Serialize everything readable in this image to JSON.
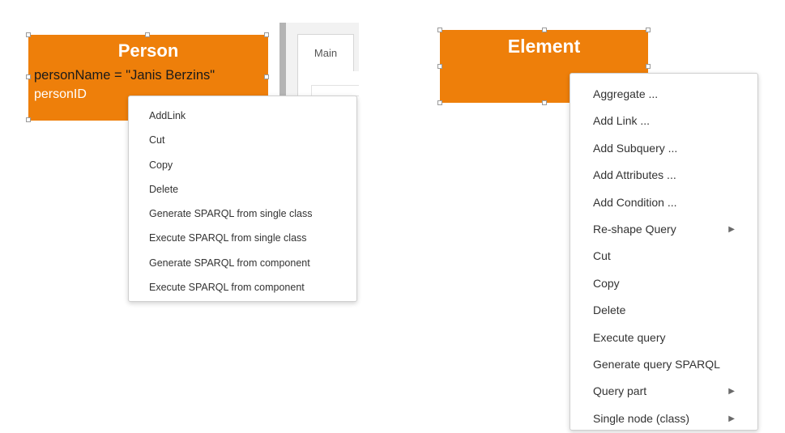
{
  "person_class": {
    "title": "Person",
    "attributes": [
      "personName = \"Janis Berzins\"",
      "personID"
    ]
  },
  "element_class": {
    "title": "Element"
  },
  "side_panel": {
    "tab_label": "Main"
  },
  "left_context_menu": {
    "items": [
      "AddLink",
      "Cut",
      "Copy",
      "Delete",
      "Generate SPARQL from single class",
      "Execute SPARQL from single class",
      "Generate SPARQL from component",
      "Execute SPARQL from component"
    ]
  },
  "right_context_menu": {
    "items": [
      {
        "label": "Aggregate ...",
        "submenu": false
      },
      {
        "label": "Add Link ...",
        "submenu": false
      },
      {
        "label": "Add Subquery ...",
        "submenu": false
      },
      {
        "label": "Add Attributes ...",
        "submenu": false
      },
      {
        "label": "Add Condition ...",
        "submenu": false
      },
      {
        "label": "Re-shape Query",
        "submenu": true
      },
      {
        "label": "Cut",
        "submenu": false
      },
      {
        "label": "Copy",
        "submenu": false
      },
      {
        "label": "Delete",
        "submenu": false
      },
      {
        "label": "Execute query",
        "submenu": false
      },
      {
        "label": "Generate query SPARQL",
        "submenu": false
      },
      {
        "label": "Query part",
        "submenu": true
      },
      {
        "label": "Single node (class)",
        "submenu": true
      }
    ],
    "submenu_arrow_icon": "triangle-right-icon",
    "submenu_arrow_glyph": "▶"
  },
  "colors": {
    "class_fill": "#ee7f0a",
    "class_text": "#ffffff",
    "menu_text": "#333333"
  }
}
